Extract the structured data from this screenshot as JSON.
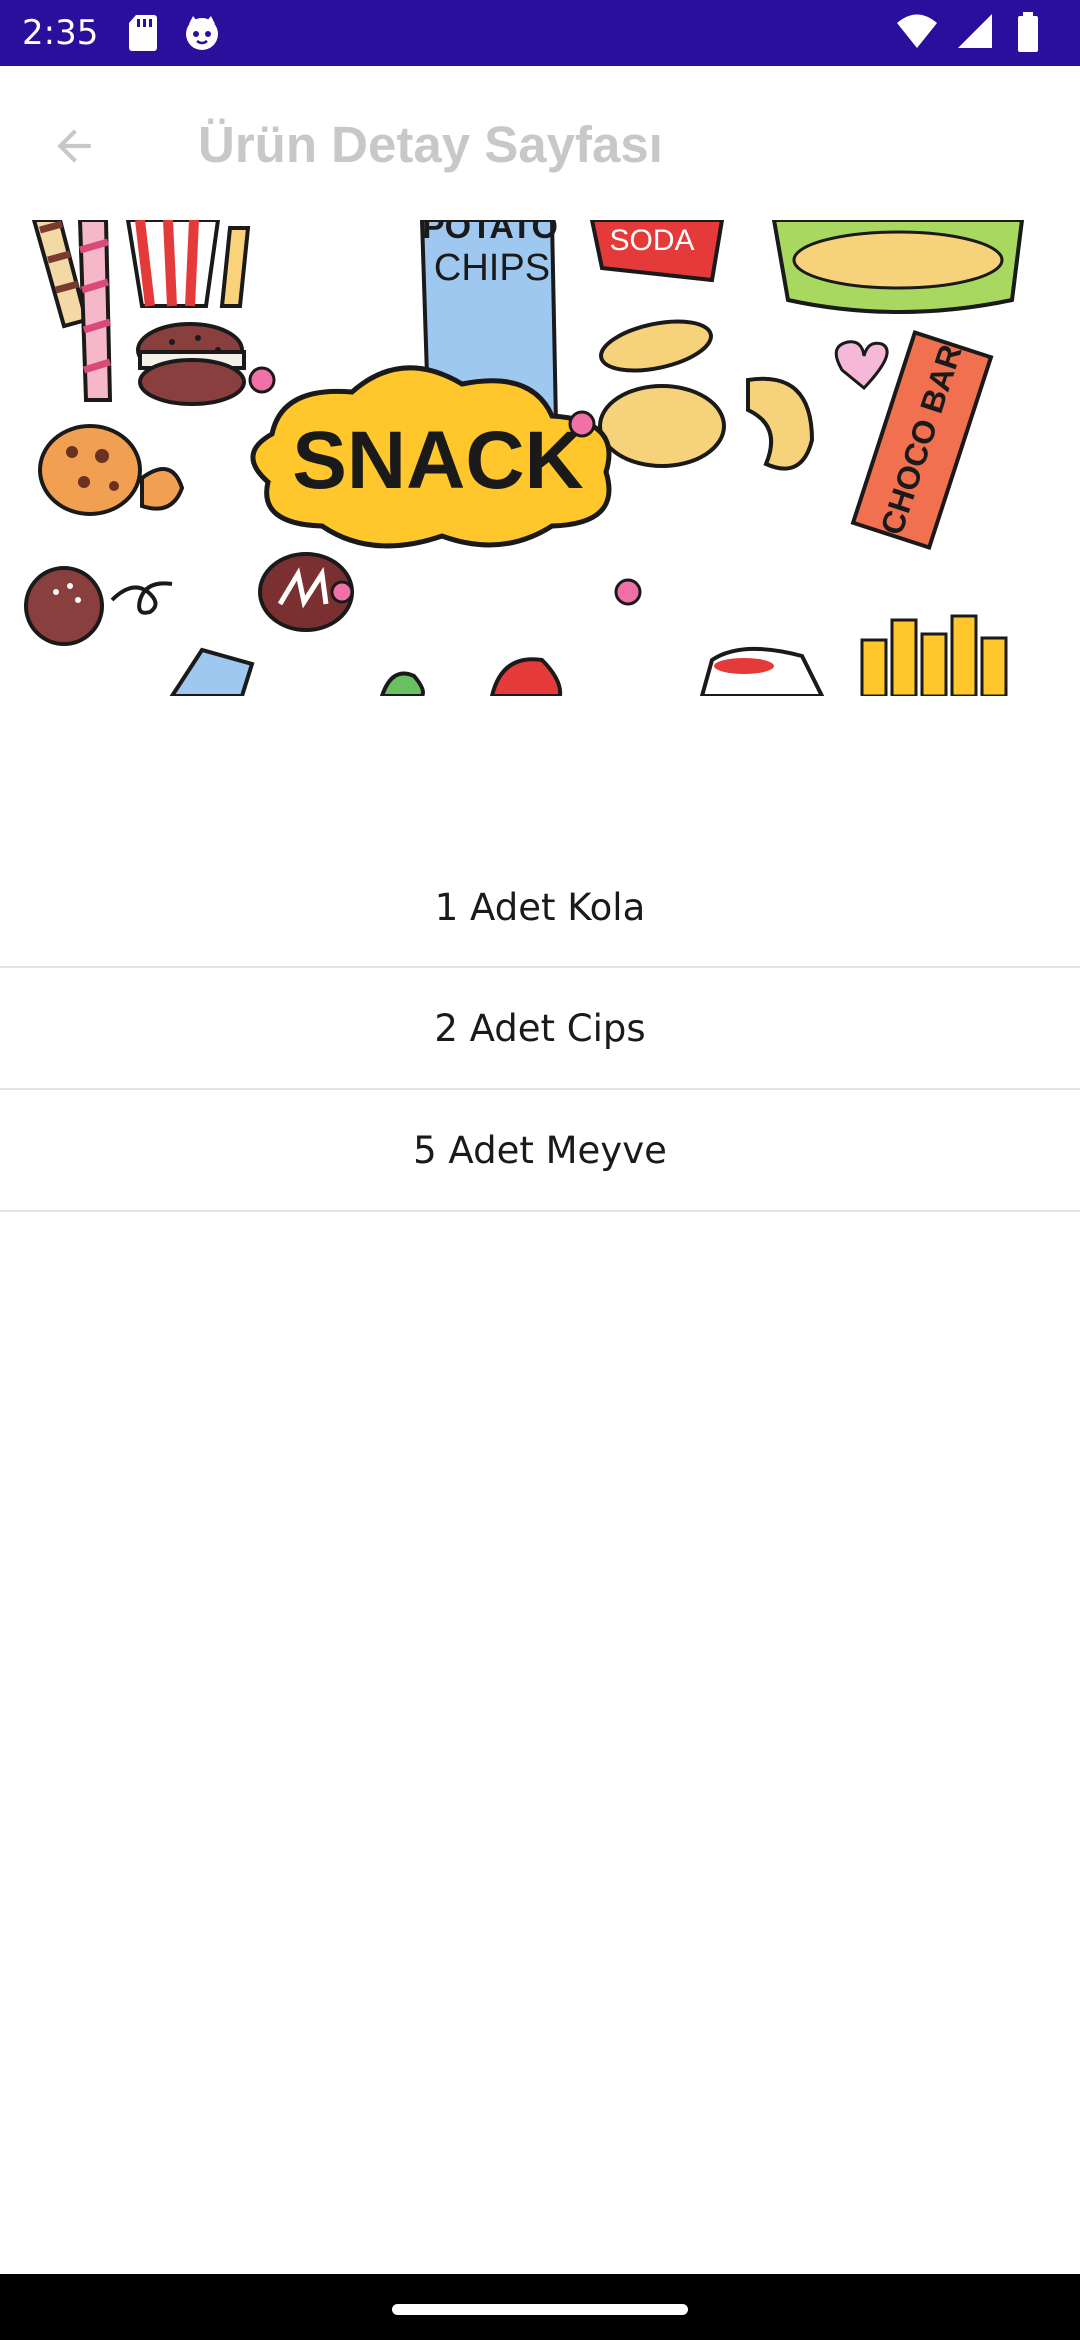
{
  "status_bar": {
    "time": "2:35",
    "left_icons": [
      "sd-card-icon",
      "cat-face-icon"
    ],
    "right_icons": [
      "wifi-icon",
      "cell-signal-icon",
      "battery-icon"
    ],
    "background_color": "#2a0e9c"
  },
  "app_bar": {
    "back_icon": "arrow-back-icon",
    "title": "Ürün Detay Sayfası"
  },
  "hero_image": {
    "description_icon": "snack-illustration",
    "text": {
      "snack": "SNACK",
      "potato_chips_1": "POTATO",
      "potato_chips_2": "CHIPS",
      "soda": "SODA",
      "choco_bar": "CHOCO BAR"
    }
  },
  "list": {
    "items": [
      {
        "label": "1 Adet Kola"
      },
      {
        "label": "2 Adet Cips"
      },
      {
        "label": "5 Adet Meyve"
      }
    ]
  }
}
